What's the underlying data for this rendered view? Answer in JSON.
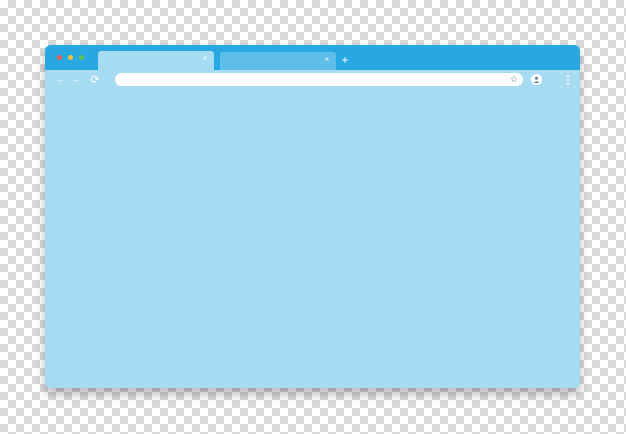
{
  "window": {
    "controls": [
      "close",
      "minimize",
      "maximize"
    ],
    "colors": {
      "titlebar": "#28a8e2",
      "active_tab": "#a6dbf2",
      "inactive_tab": "#5fbde9",
      "content": "#a6dbf2",
      "close": "#ef5b4f",
      "minimize": "#f3c03b",
      "maximize": "#60c14a"
    }
  },
  "tabs": [
    {
      "title": "",
      "close_glyph": "×",
      "active": true
    },
    {
      "title": "",
      "close_glyph": "×",
      "active": false
    }
  ],
  "new_tab_glyph": "+",
  "toolbar": {
    "back_glyph": "←",
    "forward_glyph": "→",
    "reload_glyph": "⟳",
    "address_value": "",
    "bookmark_glyph": "☆",
    "icons": [
      "back-arrow-icon",
      "forward-arrow-icon",
      "reload-icon",
      "star-icon",
      "profile-icon",
      "kebab-menu-icon"
    ]
  }
}
